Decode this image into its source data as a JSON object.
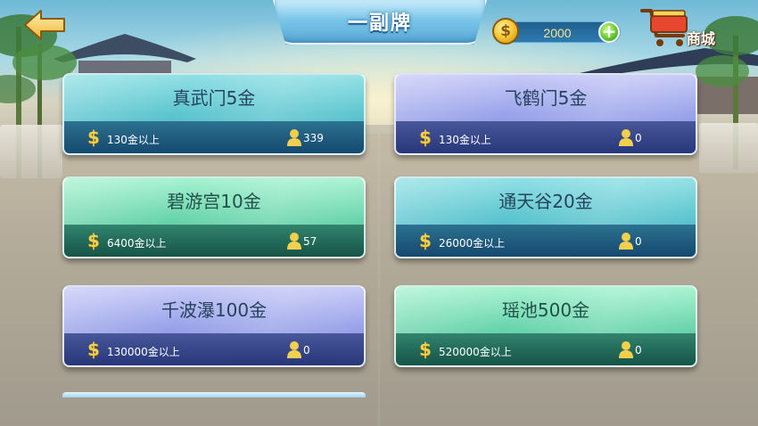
{
  "header": {
    "title": "一副牌",
    "coins": "2000",
    "shop_label": "商城"
  },
  "rooms": [
    {
      "name": "真武门5金",
      "requirement": "130金以上",
      "players": "339",
      "theme": "teal"
    },
    {
      "name": "飞鹤门5金",
      "requirement": "130金以上",
      "players": "0",
      "theme": "purple"
    },
    {
      "name": "碧游宫10金",
      "requirement": "6400金以上",
      "players": "57",
      "theme": "green"
    },
    {
      "name": "通天谷20金",
      "requirement": "26000金以上",
      "players": "0",
      "theme": "teal"
    },
    {
      "name": "千波瀑100金",
      "requirement": "130000金以上",
      "players": "0",
      "theme": "purple"
    },
    {
      "name": "瑶池500金",
      "requirement": "520000金以上",
      "players": "0",
      "theme": "green"
    }
  ],
  "icons": {
    "currency_symbol": "$",
    "coin_symbol": "$",
    "add_symbol": "+"
  },
  "colors": {
    "accent_gold": "#f3cf4e",
    "title_blue": "#58a9d6"
  }
}
